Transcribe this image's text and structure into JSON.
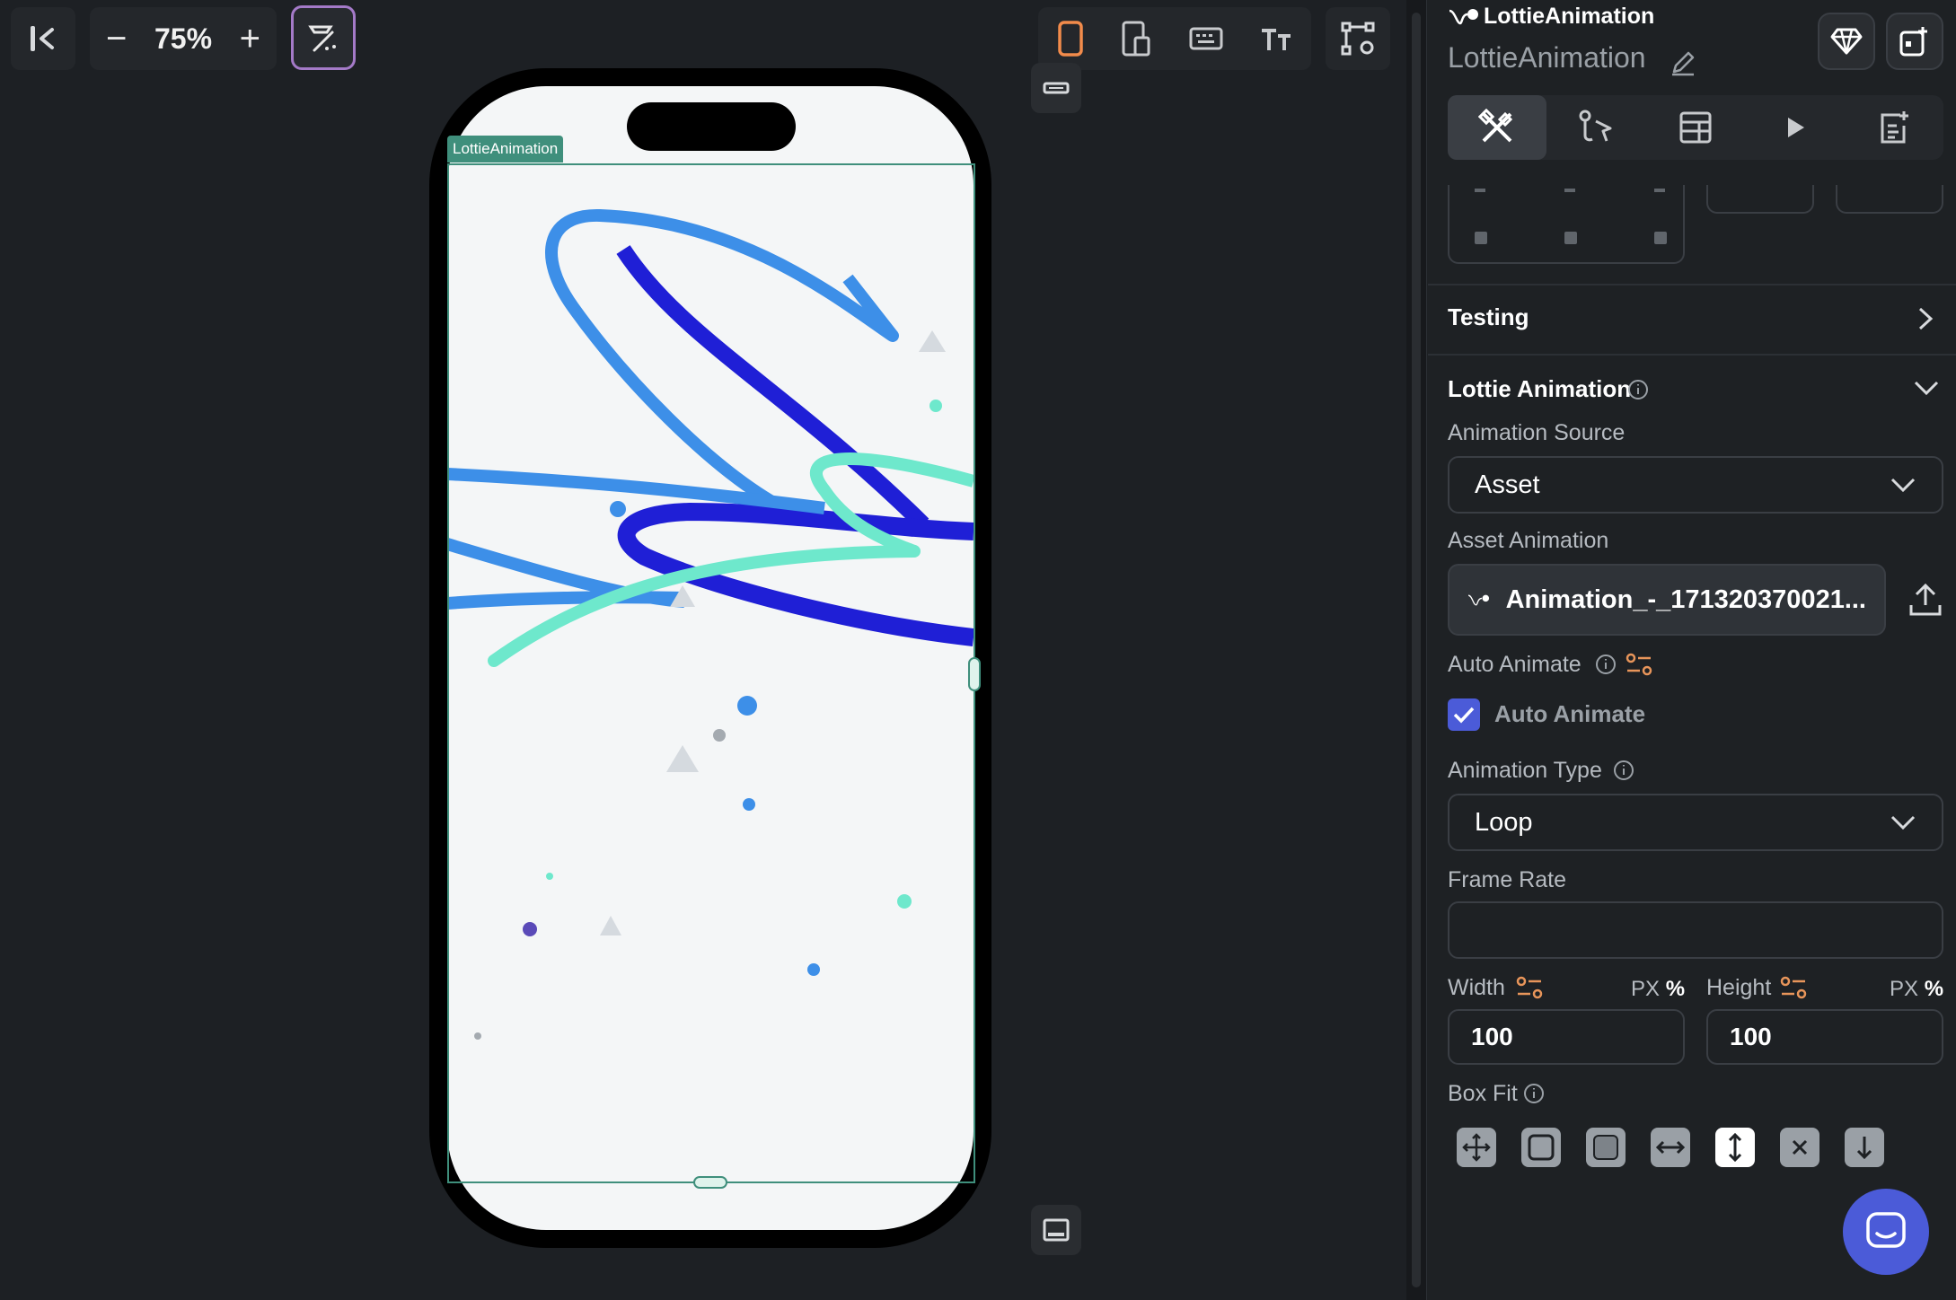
{
  "toolbar": {
    "zoom_level": "75%",
    "zoom_out_symbol": "−",
    "zoom_in_symbol": "+",
    "icons": [
      "collapse-panel-icon",
      "magic-wand-icon",
      "phone-icon",
      "tablet-icon",
      "keyboard-icon",
      "text-size-icon",
      "settings-graph-icon"
    ]
  },
  "canvas": {
    "widget_label": "LottieAnimation",
    "accent": "#3f8f7c"
  },
  "panel": {
    "widget_type": "LottieAnimation",
    "widget_name": "LottieAnimation",
    "testing": "Testing",
    "lottie_section": "Lottie Animation",
    "animation_source_label": "Animation Source",
    "animation_source_value": "Asset",
    "asset_animation_label": "Asset Animation",
    "asset_animation_value": "Animation_-_171320370021...",
    "auto_animate_label": "Auto Animate",
    "auto_animate_checkbox_label": "Auto Animate",
    "auto_animate_checked": true,
    "animation_type_label": "Animation Type",
    "animation_type_value": "Loop",
    "frame_rate_label": "Frame Rate",
    "frame_rate_value": "",
    "width_label": "Width",
    "width_value": "100",
    "width_unit_px": "PX",
    "width_unit_pct": "%",
    "height_label": "Height",
    "height_value": "100",
    "height_unit_px": "PX",
    "height_unit_pct": "%",
    "box_fit_label": "Box Fit",
    "accent": "#4b5bd8"
  }
}
